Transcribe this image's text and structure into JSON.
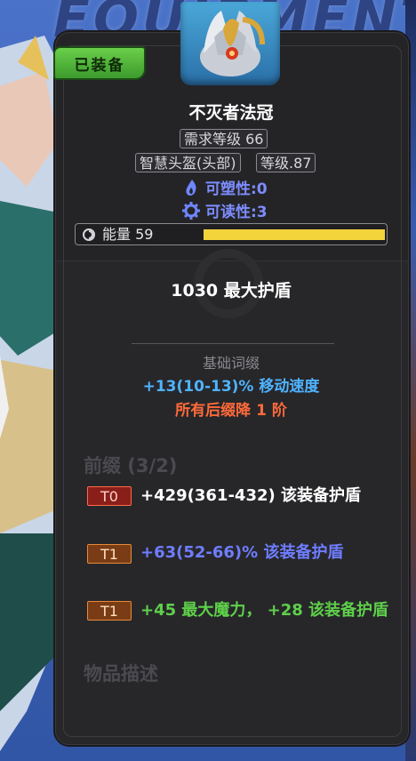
{
  "background": {
    "header_text": "EQUIPMENT"
  },
  "badge": {
    "equipped": "已装备"
  },
  "item": {
    "name": "不灭者法冠",
    "requirement": "需求等级 66",
    "type": "智慧头盔(头部)",
    "level": "等级.87",
    "plasticity": "可塑性:0",
    "readability": "可读性:3"
  },
  "energy": {
    "label": "能量 59",
    "fill_fraction": 1.0
  },
  "base": {
    "shield": "1030 最大护盾"
  },
  "base_affix": {
    "title": "基础词缀",
    "line1": "+13(10-13)% 移动速度",
    "line2": "所有后缀降 1 阶"
  },
  "prefix": {
    "header": "前缀 (3/2)",
    "mods": [
      {
        "tier": "T0",
        "text": "+429(361-432) 该装备护盾",
        "color": "white"
      },
      {
        "tier": "T1",
        "text": "+63(52-66)% 该装备护盾",
        "color": "blue"
      },
      {
        "tier": "T1",
        "text": "+45 最大魔力， +28 该装备护盾",
        "color": "green"
      }
    ]
  },
  "description_header": "物品描述",
  "icons": {
    "plasticity": "flame-icon",
    "readability": "gear-icon",
    "energy": "energy-swirl-icon",
    "item": "crown-helm-icon"
  },
  "colors": {
    "panel_bg": "#242427",
    "equipped_green": "#5ac23c",
    "energy_yellow": "#f3d43a",
    "affix_blue": "#4fb3ff",
    "affix_red": "#ff6a3a",
    "mod_blue": "#6f7dff",
    "mod_green": "#5ed04a"
  }
}
